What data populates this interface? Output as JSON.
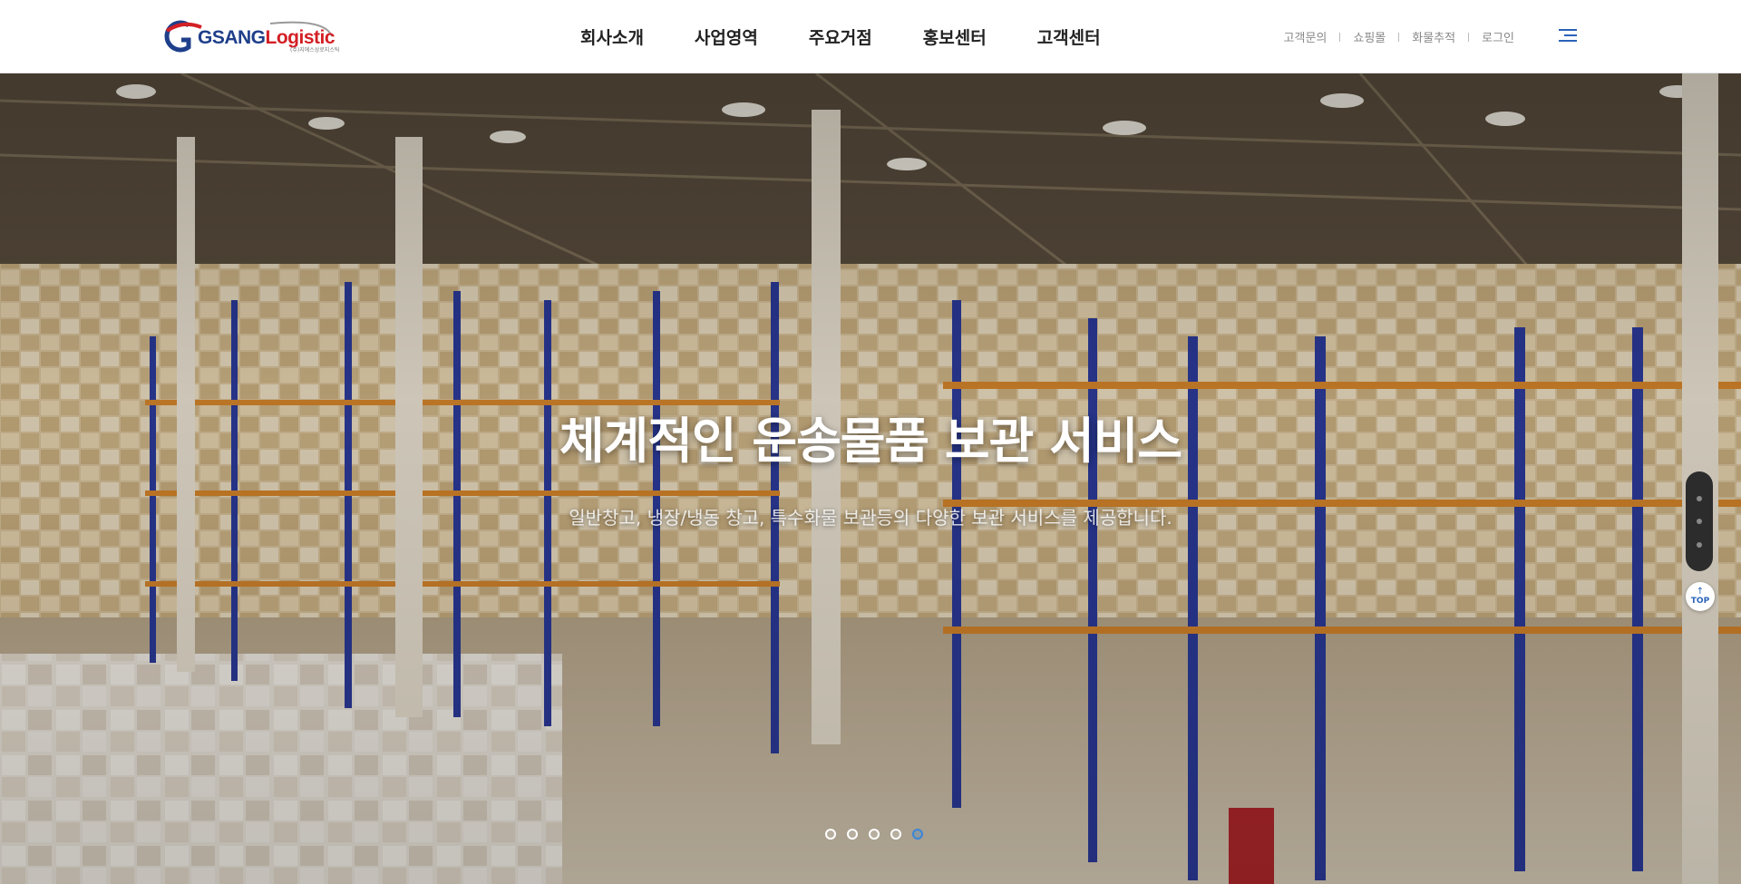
{
  "brand": {
    "logo_part1": "GSANG",
    "logo_part2": "Logistic",
    "logo_sub": "(주)지에스상로지스틱"
  },
  "gnb": {
    "items": [
      {
        "label": "회사소개"
      },
      {
        "label": "사업영역"
      },
      {
        "label": "주요거점"
      },
      {
        "label": "홍보센터"
      },
      {
        "label": "고객센터"
      }
    ]
  },
  "util": {
    "items": [
      {
        "label": "고객문의"
      },
      {
        "label": "쇼핑몰"
      },
      {
        "label": "화물추적"
      },
      {
        "label": "로그인"
      }
    ]
  },
  "hero": {
    "title": "체계적인 운송물품 보관 서비스",
    "subtitle": "일반창고, 냉장/냉동 창고, 특수화물 보관등의 다양한 보관 서비스를 제공합니다.",
    "slide_count": 5,
    "active_slide": 5
  },
  "side": {
    "top_label": "TOP",
    "top_arrow": "↑"
  },
  "colors": {
    "accent": "#2a62b8",
    "brand_red": "#d32026",
    "brand_blue": "#1e3f8a",
    "active_dot": "#3b86d8"
  }
}
